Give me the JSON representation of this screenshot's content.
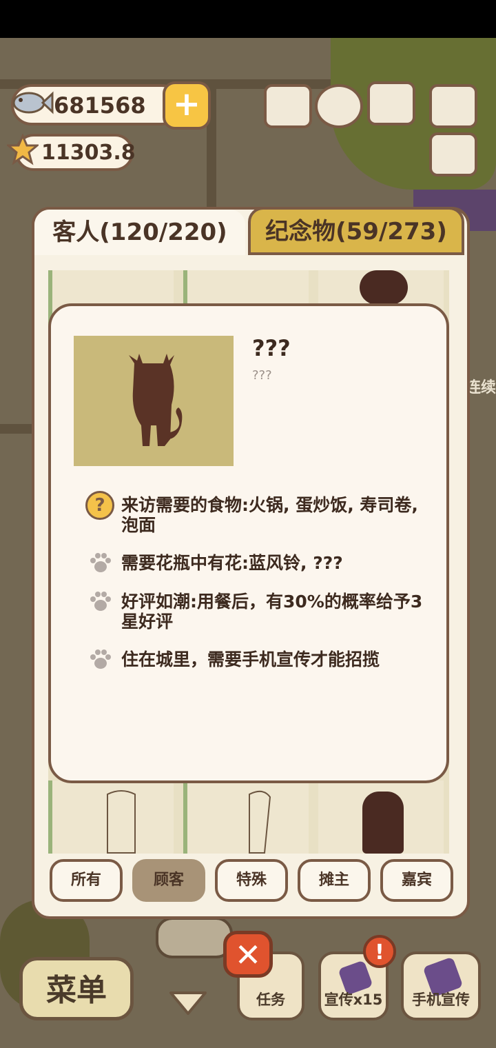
{
  "currency": {
    "fish": "681568",
    "stars": "11303.8",
    "add_label": "+"
  },
  "top_icons": [
    "ranking-icon",
    "gear-icon",
    "book-icon",
    "camera-icon",
    "newspaper-icon"
  ],
  "side_text": "连续",
  "tabs": {
    "guests": "客人(120/220)",
    "souvenirs": "纪念物(59/273)"
  },
  "filters": [
    "所有",
    "顾客",
    "特殊",
    "摊主",
    "嘉宾"
  ],
  "active_filter": "顾客",
  "customer": {
    "name": "???",
    "subtitle": "???",
    "requirements": [
      {
        "icon": "question-icon",
        "text": "来访需要的食物:火锅, 蛋炒饭, 寿司卷, 泡面"
      },
      {
        "icon": "paw-icon",
        "text": "需要花瓶中有花:蓝风铃, ???"
      },
      {
        "icon": "paw-icon",
        "text": "好评如潮:用餐后，有30%的概率给予3星好评"
      },
      {
        "icon": "paw-icon",
        "text": "住在城里，需要手机宣传才能招揽"
      }
    ]
  },
  "bottom": {
    "menu": "菜单",
    "close": "✕",
    "tasks": "任务",
    "promo": "宣传x15",
    "phone_promo": "手机宣传",
    "alert": "!"
  },
  "colors": {
    "accent": "#7a5a45",
    "tab_inactive": "#d9b54a",
    "popup_bg": "#fcf6ee",
    "silhouette": "#5a3326"
  }
}
